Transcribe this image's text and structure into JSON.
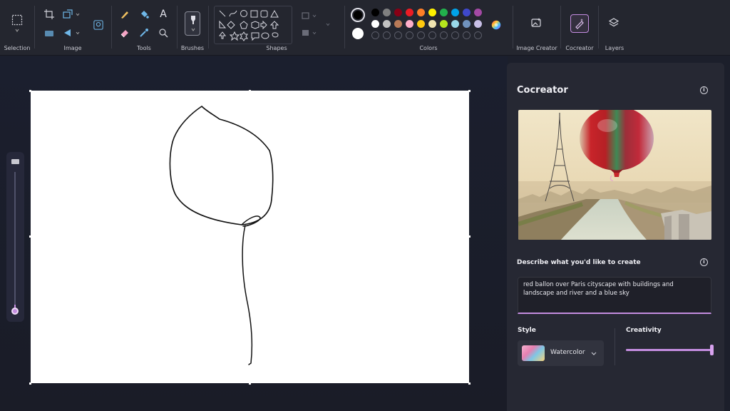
{
  "toolbar": {
    "groups": {
      "selection": "Selection",
      "image": "Image",
      "tools": "Tools",
      "brushes": "Brushes",
      "shapes": "Shapes",
      "colors": "Colors",
      "image_creator": "Image Creator",
      "cocreator": "Cocreator",
      "layers": "Layers"
    },
    "tools_text_glyph": "A",
    "icons": [
      "selection-rect-icon",
      "crop-icon",
      "resize-icon",
      "rotate-icon",
      "flip-icon",
      "remove-background-icon",
      "pencil-icon",
      "fill-icon",
      "text-icon",
      "eraser-icon",
      "color-picker-icon",
      "magnifier-icon",
      "brush-icon",
      "shapes-icon",
      "color-wheel-icon",
      "image-creator-icon",
      "cocreator-icon",
      "layers-icon"
    ],
    "colors": {
      "primary": "#000000",
      "secondary": "#ffffff",
      "row1": [
        "#000000",
        "#7f7f7f",
        "#880015",
        "#ed1c24",
        "#ff7f27",
        "#fff200",
        "#22b14c",
        "#00a2e8",
        "#3f48cc",
        "#a349a4"
      ],
      "row2": [
        "#ffffff",
        "#c3c3c3",
        "#b97a57",
        "#ffaec9",
        "#ffc90e",
        "#efe4b0",
        "#b5e61d",
        "#99d9ea",
        "#7092be",
        "#c8bfe7"
      ]
    }
  },
  "panel": {
    "title": "Cocreator",
    "prompt_label": "Describe what you'd like to create",
    "prompt_text": "red ballon over Paris cityscape with buildings and landscape and river and a blue sky",
    "style_label": "Style",
    "style_value": "Watercolor",
    "creativity_label": "Creativity",
    "creativity_level": 1.0
  },
  "accent_color": "#c48de0"
}
